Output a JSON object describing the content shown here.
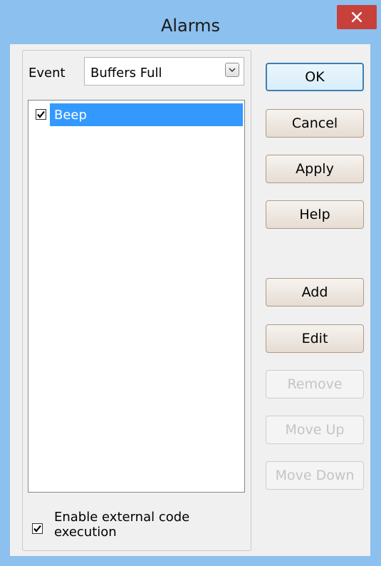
{
  "window": {
    "title": "Alarms",
    "close_icon": "close-icon"
  },
  "event": {
    "label": "Event",
    "selected": "Buffers Full"
  },
  "alarm_list": {
    "items": [
      {
        "label": "Beep",
        "checked": true,
        "selected": true
      }
    ]
  },
  "options": {
    "enable_external_code_line1": "Enable external code",
    "enable_external_code_line2": "execution",
    "enable_external_code_checked": true
  },
  "buttons": {
    "ok": "OK",
    "cancel": "Cancel",
    "apply": "Apply",
    "help": "Help",
    "add": "Add",
    "edit": "Edit",
    "remove": "Remove",
    "move_up": "Move Up",
    "move_down": "Move Down"
  },
  "colors": {
    "frame": "#8cc0ee",
    "close": "#c7413a",
    "selection": "#3399ff"
  }
}
